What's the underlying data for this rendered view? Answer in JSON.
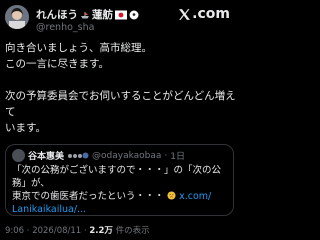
{
  "author": {
    "display_name": "れんほう",
    "display_name_suffix": "蓮舫",
    "handle": "@renho_sha"
  },
  "brand": {
    "logo_text": ".com"
  },
  "tweet": {
    "line1": "向き合いましょう、高市総理。",
    "line2": "この一言に尽きます。",
    "line3": "次の予算委員会でお伺いすることがどんどん増えて",
    "line4": "います。"
  },
  "quote": {
    "name": "谷本惠美",
    "handle": "@odayakaobaa",
    "time": "1日",
    "text_line1": "「次の公務がございますので・・・」の「次の公務」が、",
    "text_line2": "東京での歯医者だったという・・・",
    "link_inline": "x.com/",
    "link_line": "Lanikaikailua/..."
  },
  "footer": {
    "time": "9:06",
    "date": "2026/08/11",
    "views": "2.2万",
    "views_label": "件の表示"
  },
  "colors": {
    "background": "#000000",
    "text": "#e7e9ea",
    "muted": "#71767b",
    "link": "#1d9bf0",
    "border": "#2f3336"
  }
}
